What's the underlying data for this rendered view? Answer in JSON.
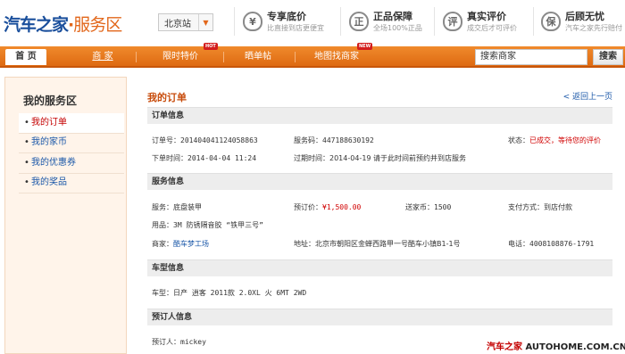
{
  "header": {
    "logo_main": "汽车之家",
    "logo_dot": "·",
    "logo_service": "服务区",
    "city": "北京站",
    "city_arrow": "▼",
    "promos": [
      {
        "icon_char": "¥",
        "title": "专享底价",
        "subtitle": "比直接到店更便宜"
      },
      {
        "icon_char": "正",
        "title": "正品保障",
        "subtitle": "全场100%正品"
      },
      {
        "icon_char": "评",
        "title": "真实评价",
        "subtitle": "成交后才可评价"
      },
      {
        "icon_char": "保",
        "title": "后顾无忧",
        "subtitle": "汽车之家先行赔付"
      }
    ]
  },
  "nav": {
    "items": [
      "首 页",
      "商 家",
      "限时特价",
      "晒单帖",
      "地图找商家"
    ],
    "tags": {
      "hot": "HOT",
      "new": "NEW"
    },
    "search_placeholder": "搜索商家",
    "search_button": "搜索"
  },
  "sidebar": {
    "title": "我的服务区",
    "bullet": "•",
    "items": [
      "我的订单",
      "我的家币",
      "我的优惠券",
      "我的奖品"
    ]
  },
  "main": {
    "page_title": "我的订单",
    "back_link": "< 返回上一页",
    "sections": {
      "order": "订单信息",
      "service": "服务信息",
      "car": "车型信息",
      "booker": "预订人信息"
    },
    "order": {
      "order_no_label": "订单号：",
      "order_no": "201404041124058863",
      "service_code_label": "服务码：",
      "service_code": "447188630192",
      "status_label": "状态：",
      "status": "已成交，等待您的评价",
      "order_time_label": "下单时间：",
      "order_time": "2014-04-04 11:24",
      "expire_label": "过期时间：",
      "expire_value": "2014-04-19 请于此时间前预约并到店服务"
    },
    "service": {
      "service_label": "服务：",
      "service_value": "底盘装甲",
      "price_label": "预订价：",
      "price_value": "¥1,500.00",
      "coins_label": "送家币：",
      "coins_value": "1500",
      "payment_label": "支付方式：",
      "payment_value": "到店付款",
      "product_label": "用品：",
      "product_value": "3M 防锈隔音胶 “铁甲三号”",
      "merchant_label": "商家：",
      "merchant_value": "酷车梦工场",
      "address_label": "地址：",
      "address_value": "北京市朝阳区金蝉西路甲一号酷车小镇B1-1号",
      "phone_label": "电话：",
      "phone_value": "4008108876-1791"
    },
    "car": {
      "model_label": "车型：",
      "model_value": "日产 逍客 2011款 2.0XL 火 6MT 2WD"
    },
    "booker": {
      "name_label": "预订人：",
      "name_value": "mickey"
    }
  },
  "watermark": {
    "brand": "汽车之家",
    "site": "AUTOHOME.COM.CN"
  },
  "colors": {
    "nav_orange": "#e8761c",
    "title_orange": "#c74b0b",
    "link_blue": "#1a57a8",
    "alert_red": "#d00000"
  }
}
